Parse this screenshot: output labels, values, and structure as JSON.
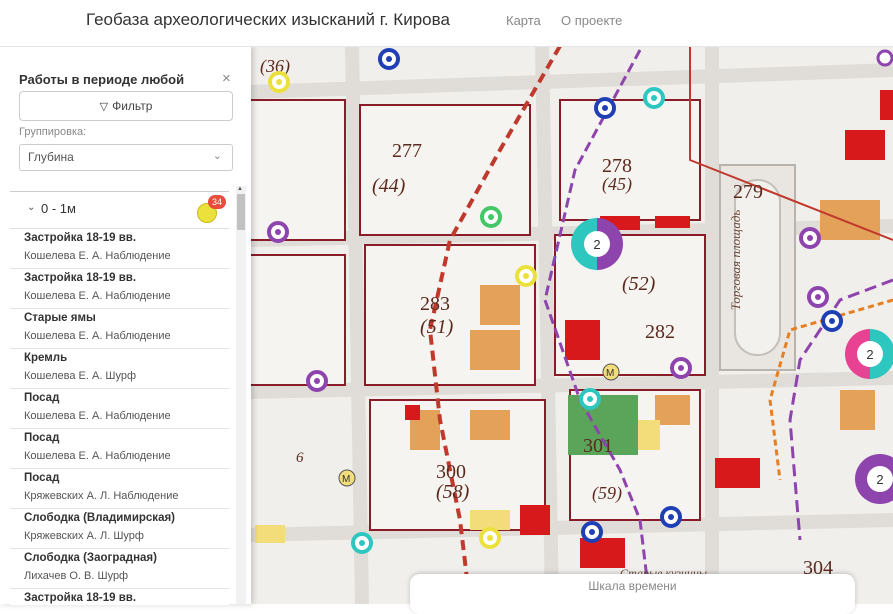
{
  "header": {
    "title": "Геобаза археологических изысканий г. Кирова",
    "nav": [
      "Карта",
      "О проекте"
    ]
  },
  "panel": {
    "title": "Работы в периоде любой",
    "close": "×",
    "filter_label": "Фильтр",
    "grouping_label": "Группировка:",
    "grouping_value": "Глубина",
    "group": {
      "label": "0 - 1м",
      "count": "34",
      "color": "#ece13c"
    },
    "items": [
      {
        "title": "Застройка 18-19 вв.",
        "sub": "Кошелева Е. А. Наблюдение"
      },
      {
        "title": "Застройка 18-19 вв.",
        "sub": "Кошелева Е. А. Наблюдение"
      },
      {
        "title": "Старые ямы",
        "sub": "Кошелева Е. А. Наблюдение"
      },
      {
        "title": "Кремль",
        "sub": "Кошелева Е. А. Шурф"
      },
      {
        "title": "Посад",
        "sub": "Кошелева Е. А. Наблюдение"
      },
      {
        "title": "Посад",
        "sub": "Кошелева Е. А. Наблюдение"
      },
      {
        "title": "Посад",
        "sub": "Кряжевских А. Л. Наблюдение"
      },
      {
        "title": "Слободка (Владимирская)",
        "sub": "Кряжевских А. Л. Шурф"
      },
      {
        "title": "Слободка (Заоградная)",
        "sub": "Лихачев О. В. Шурф"
      },
      {
        "title": "Застройка 18-19 вв.",
        "sub": ""
      }
    ]
  },
  "map": {
    "blocks": [
      {
        "num": "277",
        "sub": "(44)"
      },
      {
        "num": "278",
        "sub": "(45)"
      },
      {
        "num": "279"
      },
      {
        "num": "283",
        "sub": "(51)"
      },
      {
        "sub": "(52)"
      },
      {
        "num": "282"
      },
      {
        "num": "300",
        "sub": "(58)"
      },
      {
        "num": "301",
        "sub": "(59)"
      },
      {
        "num": "304"
      },
      {
        "sub": "(36)"
      },
      {
        "num": "6"
      }
    ],
    "streets": [
      "Торговая площадь",
      "Старые кузницы",
      "М",
      "М"
    ],
    "clusters": [
      "2",
      "2",
      "2"
    ]
  },
  "timeline": {
    "label": "Шкала времени"
  }
}
